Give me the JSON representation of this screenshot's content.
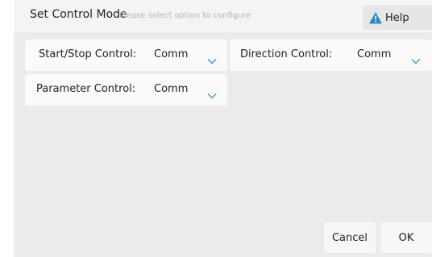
{
  "dialog": {
    "title": "Set Control Mode",
    "subtitle": "Please select option to configure",
    "help_label": "Help"
  },
  "fields": {
    "start_stop": {
      "label": "Start/Stop Control:",
      "value": "Comm"
    },
    "direction": {
      "label": "Direction Control:",
      "value": "Comm"
    },
    "parameter": {
      "label": "Parameter Control:",
      "value": "Comm"
    }
  },
  "footer": {
    "cancel_label": "Cancel",
    "ok_label": "OK"
  },
  "colors": {
    "accent": "#3a9ad9",
    "warning_icon": "#2f86c8"
  },
  "icons": {
    "help": "warning-triangle-icon",
    "dropdown": "chevron-down-icon"
  }
}
